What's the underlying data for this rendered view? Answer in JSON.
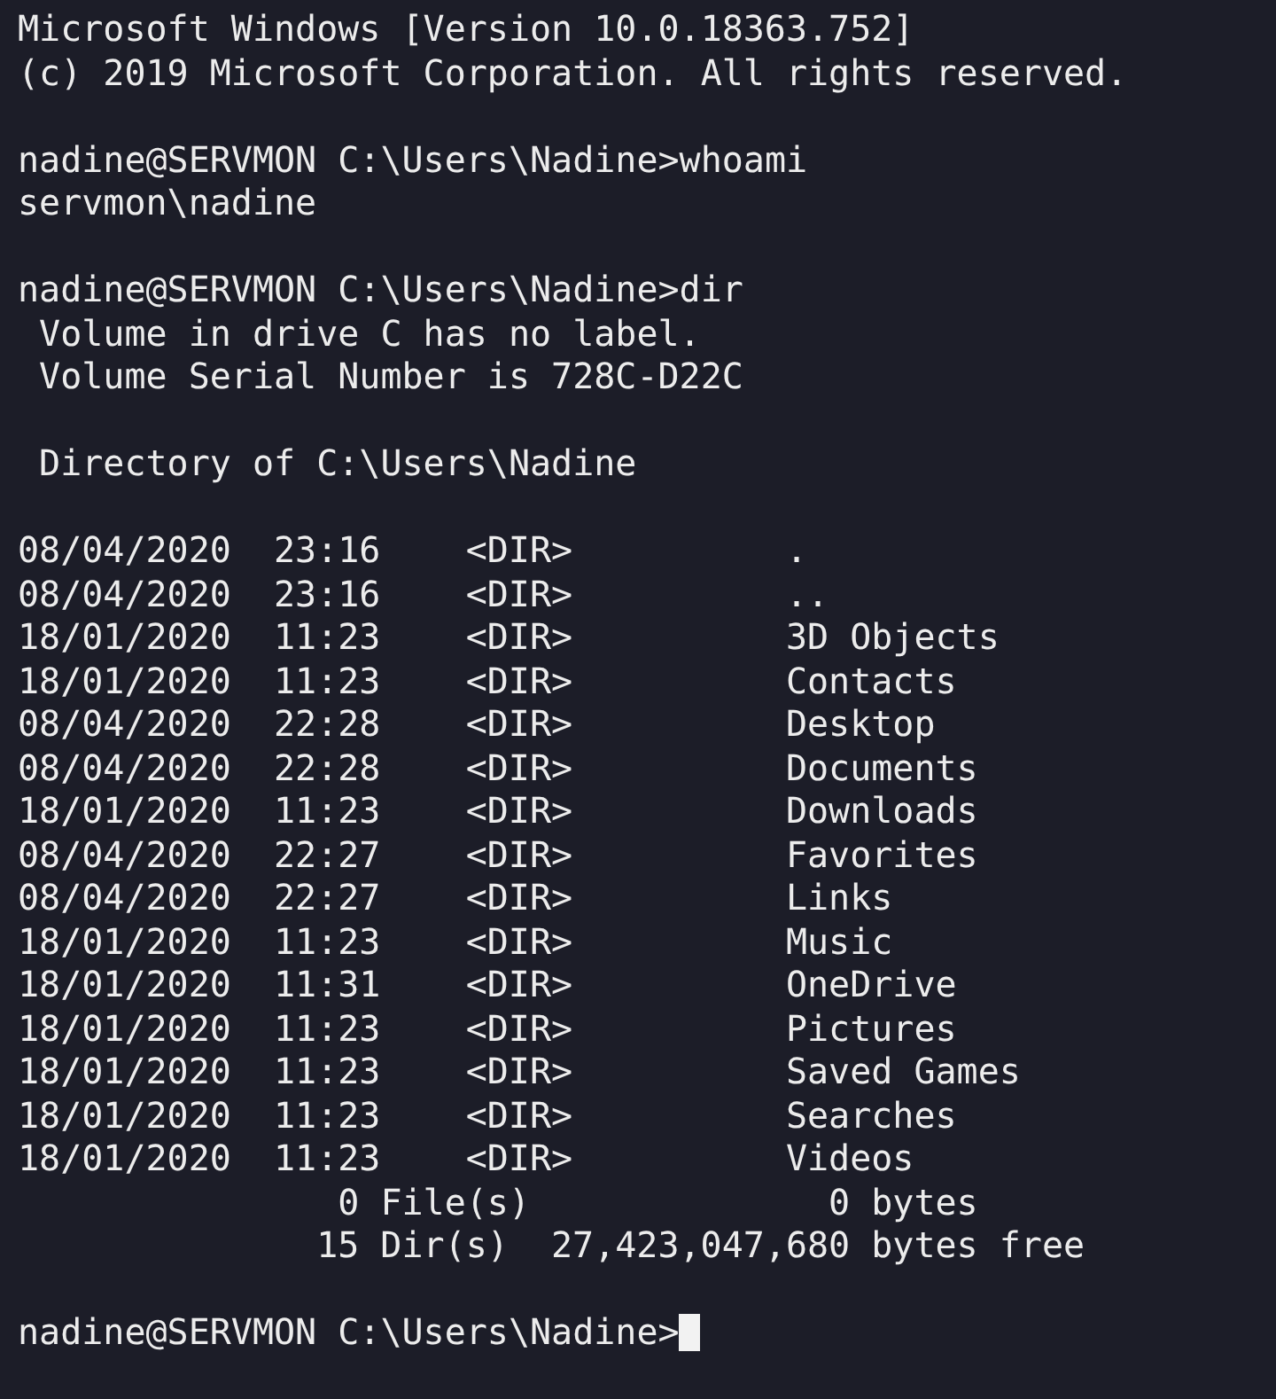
{
  "terminal": {
    "lines": [
      {
        "kind": "text",
        "text": "Microsoft Windows [Version 10.0.18363.752]"
      },
      {
        "kind": "text",
        "text": "(c) 2019 Microsoft Corporation. All rights reserved."
      },
      {
        "kind": "blank"
      },
      {
        "kind": "prompt",
        "prompt": "nadine@SERVMON C:\\Users\\Nadine>",
        "command": "whoami",
        "cursor": false
      },
      {
        "kind": "text",
        "text": "servmon\\nadine"
      },
      {
        "kind": "blank"
      },
      {
        "kind": "prompt",
        "prompt": "nadine@SERVMON C:\\Users\\Nadine>",
        "command": "dir",
        "cursor": false
      },
      {
        "kind": "text",
        "text": " Volume in drive C has no label."
      },
      {
        "kind": "text",
        "text": " Volume Serial Number is 728C-D22C"
      },
      {
        "kind": "blank"
      },
      {
        "kind": "text",
        "text": " Directory of C:\\Users\\Nadine"
      },
      {
        "kind": "blank"
      },
      {
        "kind": "entry",
        "date": "08/04/2020",
        "time": "23:16",
        "type": "<DIR>",
        "name": "."
      },
      {
        "kind": "entry",
        "date": "08/04/2020",
        "time": "23:16",
        "type": "<DIR>",
        "name": ".."
      },
      {
        "kind": "entry",
        "date": "18/01/2020",
        "time": "11:23",
        "type": "<DIR>",
        "name": "3D Objects"
      },
      {
        "kind": "entry",
        "date": "18/01/2020",
        "time": "11:23",
        "type": "<DIR>",
        "name": "Contacts"
      },
      {
        "kind": "entry",
        "date": "08/04/2020",
        "time": "22:28",
        "type": "<DIR>",
        "name": "Desktop"
      },
      {
        "kind": "entry",
        "date": "08/04/2020",
        "time": "22:28",
        "type": "<DIR>",
        "name": "Documents"
      },
      {
        "kind": "entry",
        "date": "18/01/2020",
        "time": "11:23",
        "type": "<DIR>",
        "name": "Downloads"
      },
      {
        "kind": "entry",
        "date": "08/04/2020",
        "time": "22:27",
        "type": "<DIR>",
        "name": "Favorites"
      },
      {
        "kind": "entry",
        "date": "08/04/2020",
        "time": "22:27",
        "type": "<DIR>",
        "name": "Links"
      },
      {
        "kind": "entry",
        "date": "18/01/2020",
        "time": "11:23",
        "type": "<DIR>",
        "name": "Music"
      },
      {
        "kind": "entry",
        "date": "18/01/2020",
        "time": "11:31",
        "type": "<DIR>",
        "name": "OneDrive"
      },
      {
        "kind": "entry",
        "date": "18/01/2020",
        "time": "11:23",
        "type": "<DIR>",
        "name": "Pictures"
      },
      {
        "kind": "entry",
        "date": "18/01/2020",
        "time": "11:23",
        "type": "<DIR>",
        "name": "Saved Games"
      },
      {
        "kind": "entry",
        "date": "18/01/2020",
        "time": "11:23",
        "type": "<DIR>",
        "name": "Searches"
      },
      {
        "kind": "entry",
        "date": "18/01/2020",
        "time": "11:23",
        "type": "<DIR>",
        "name": "Videos"
      },
      {
        "kind": "files_summary",
        "count": "0 File(s)",
        "size": "0 bytes"
      },
      {
        "kind": "dirs_summary",
        "count": "15 Dir(s)",
        "size": "27,423,047,680 bytes free"
      },
      {
        "kind": "blank"
      },
      {
        "kind": "prompt",
        "prompt": "nadine@SERVMON C:\\Users\\Nadine>",
        "cursor": true
      }
    ]
  }
}
